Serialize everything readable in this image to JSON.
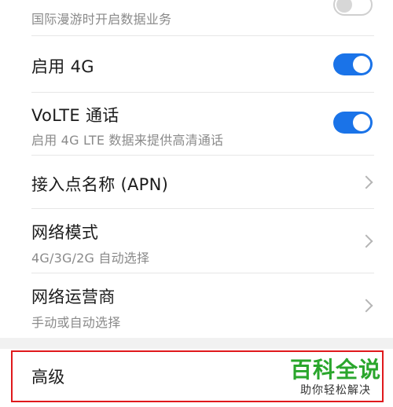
{
  "settings": {
    "items": [
      {
        "title": "",
        "subtitle": "国际漫游时开启数据业务",
        "control": "toggle",
        "on": false
      },
      {
        "title": "启用 4G",
        "subtitle": "",
        "control": "toggle",
        "on": true
      },
      {
        "title": "VoLTE 通话",
        "subtitle": "启用 4G LTE 数据来提供高清通话",
        "control": "toggle",
        "on": true
      },
      {
        "title": "接入点名称 (APN)",
        "subtitle": "",
        "control": "chevron"
      },
      {
        "title": "网络模式",
        "subtitle": "4G/3G/2G 自动选择",
        "control": "chevron"
      },
      {
        "title": "网络运营商",
        "subtitle": "手动或自动选择",
        "control": "chevron"
      }
    ],
    "advanced": {
      "title": "高级"
    }
  },
  "watermark": {
    "main": "百科全说",
    "sub": "助你轻松解决"
  },
  "colors": {
    "accent": "#1a73e8",
    "highlight": "#e0191c",
    "watermark": "#2aa62c"
  }
}
